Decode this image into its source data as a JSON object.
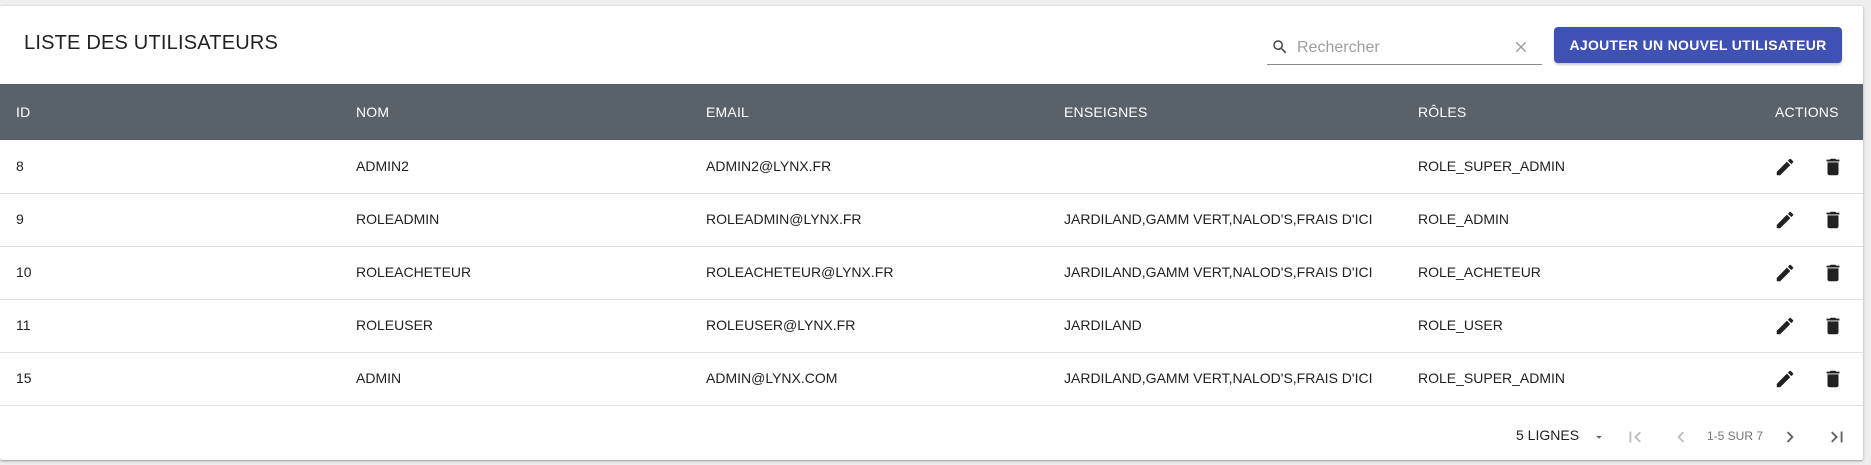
{
  "header": {
    "title": "LISTE DES UTILISATEURS",
    "search_placeholder": "Rechercher",
    "search_value": "",
    "add_button_label": "AJOUTER UN NOUVEL UTILISATEUR"
  },
  "table": {
    "columns": [
      "ID",
      "NOM",
      "EMAIL",
      "ENSEIGNES",
      "RÔLES",
      "ACTIONS"
    ],
    "rows": [
      {
        "id": "8",
        "nom": "ADMIN2",
        "email": "ADMIN2@LYNX.FR",
        "enseignes": "",
        "roles": "ROLE_SUPER_ADMIN"
      },
      {
        "id": "9",
        "nom": "ROLEADMIN",
        "email": "ROLEADMIN@LYNX.FR",
        "enseignes": "JARDILAND,GAMM VERT,NALOD'S,FRAIS D'ICI",
        "roles": "ROLE_ADMIN"
      },
      {
        "id": "10",
        "nom": "ROLEACHETEUR",
        "email": "ROLEACHETEUR@LYNX.FR",
        "enseignes": "JARDILAND,GAMM VERT,NALOD'S,FRAIS D'ICI",
        "roles": "ROLE_ACHETEUR"
      },
      {
        "id": "11",
        "nom": "ROLEUSER",
        "email": "ROLEUSER@LYNX.FR",
        "enseignes": "JARDILAND",
        "roles": "ROLE_USER"
      },
      {
        "id": "15",
        "nom": "ADMIN",
        "email": "ADMIN@LYNX.COM",
        "enseignes": "JARDILAND,GAMM VERT,NALOD'S,FRAIS D'ICI",
        "roles": "ROLE_SUPER_ADMIN"
      }
    ]
  },
  "pagination": {
    "rows_per_page_label": "5 LIGNES",
    "range_label": "1-5 SUR 7"
  },
  "icons": {
    "search": "search-icon",
    "clear": "close-icon",
    "edit": "pencil-icon",
    "delete": "trash-icon",
    "dropdown": "caret-down-icon",
    "first_page": "first-page-icon",
    "prev_page": "chevron-left-icon",
    "next_page": "chevron-right-icon",
    "last_page": "last-page-icon"
  },
  "colors": {
    "primary": "#3f51b5",
    "header_bg": "#5a6269",
    "disabled_icon": "#bdbdbd"
  }
}
